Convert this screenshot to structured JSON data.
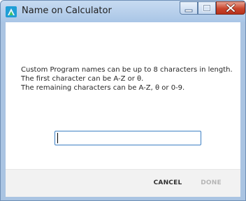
{
  "window": {
    "title": "Name on Calculator",
    "icons": {
      "app": "calculator-program-icon",
      "minimize": "minimize-icon",
      "maximize": "maximize-icon",
      "close": "close-icon"
    }
  },
  "message": {
    "line1": "Custom Program names can be up to 8 characters in length.",
    "line2": "The first character can be A-Z or θ.",
    "line3": "The remaining characters can be A-Z, θ or 0-9."
  },
  "name_input": {
    "value": "",
    "placeholder": ""
  },
  "buttons": {
    "cancel": "CANCEL",
    "done": "DONE"
  },
  "colors": {
    "accent": "#3c7fc3",
    "close_button": "#c9452c",
    "disabled_text": "#b5b5b5"
  }
}
